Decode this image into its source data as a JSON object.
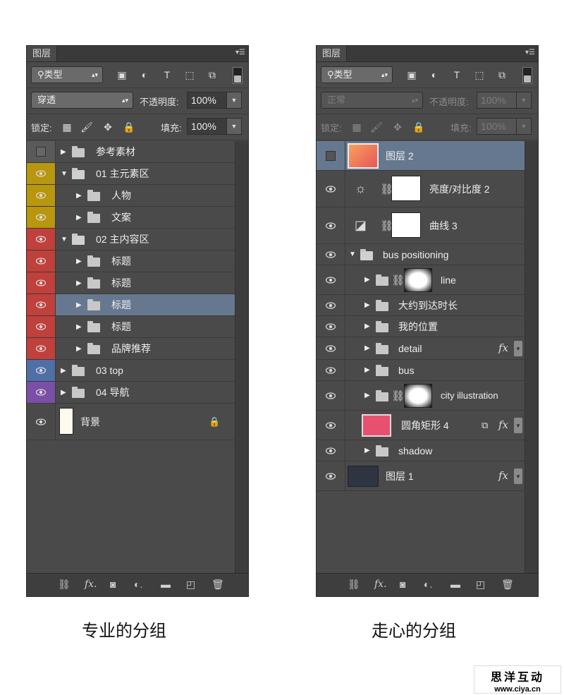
{
  "left": {
    "tab": "图层",
    "filter_label": "类型",
    "blend_mode": "穿透",
    "opacity_label": "不透明度:",
    "opacity_value": "100%",
    "lock_label": "锁定:",
    "fill_label": "填充:",
    "fill_value": "100%",
    "layers": [
      {
        "name": "参考素材",
        "color": "#5a5a5a",
        "eye": false,
        "indent": 0,
        "expanded": false
      },
      {
        "name": "01 主元素区",
        "color": "#b8960e",
        "eye": true,
        "indent": 0,
        "expanded": true
      },
      {
        "name": "人物",
        "color": "#b8960e",
        "eye": true,
        "indent": 1,
        "expanded": false
      },
      {
        "name": "文案",
        "color": "#b8960e",
        "eye": true,
        "indent": 1,
        "expanded": false
      },
      {
        "name": "02 主内容区",
        "color": "#c0403c",
        "eye": true,
        "indent": 0,
        "expanded": true
      },
      {
        "name": "标题",
        "color": "#c0403c",
        "eye": true,
        "indent": 1,
        "expanded": false
      },
      {
        "name": "标题",
        "color": "#c0403c",
        "eye": true,
        "indent": 1,
        "expanded": false
      },
      {
        "name": "标题",
        "color": "#c0403c",
        "eye": true,
        "indent": 1,
        "expanded": false,
        "selected": true
      },
      {
        "name": "标题",
        "color": "#c0403c",
        "eye": true,
        "indent": 1,
        "expanded": false
      },
      {
        "name": "品牌推荐",
        "color": "#c0403c",
        "eye": true,
        "indent": 1,
        "expanded": false
      },
      {
        "name": "03 top",
        "color": "#4f6fa6",
        "eye": true,
        "indent": 0,
        "expanded": false
      },
      {
        "name": "04 导航",
        "color": "#7a4fa6",
        "eye": true,
        "indent": 0,
        "expanded": false
      },
      {
        "name": "背景",
        "color": "#4a4a4a",
        "eye": true,
        "indent": 0,
        "background": true
      }
    ]
  },
  "right": {
    "tab": "图层",
    "filter_label": "类型",
    "blend_mode": "正常",
    "opacity_label": "不透明度:",
    "opacity_value": "100%",
    "lock_label": "锁定:",
    "fill_label": "填充:",
    "fill_value": "100%",
    "layers": [
      {
        "name": "图层 2",
        "kind": "thumb-photo",
        "selected": true,
        "eye": false
      },
      {
        "name": "亮度/对比度 2",
        "kind": "adjust-brightness",
        "eye": true
      },
      {
        "name": "曲线 3",
        "kind": "adjust-curves",
        "eye": true
      },
      {
        "name": "bus positioning",
        "kind": "group-open",
        "eye": true
      },
      {
        "name": "line",
        "kind": "group-mask",
        "eye": true
      },
      {
        "name": "大约到达时长",
        "kind": "group",
        "eye": true
      },
      {
        "name": "我的位置",
        "kind": "group",
        "eye": true
      },
      {
        "name": "detail",
        "kind": "group",
        "eye": true,
        "fx": true
      },
      {
        "name": "bus",
        "kind": "group",
        "eye": true
      },
      {
        "name": "city illustration",
        "kind": "group-mask",
        "eye": true
      },
      {
        "name": "圆角矩形 4",
        "kind": "shape",
        "eye": true,
        "fx": true
      },
      {
        "name": "shadow",
        "kind": "group",
        "eye": true
      },
      {
        "name": "图层 1",
        "kind": "thumb-dark",
        "eye": true,
        "fx": true
      }
    ],
    "fx_symbol": "fx"
  },
  "captions": {
    "left": "专业的分组",
    "right": "走心的分组"
  },
  "watermark": {
    "title": "思洋互动",
    "url": "www.ciya.cn"
  }
}
